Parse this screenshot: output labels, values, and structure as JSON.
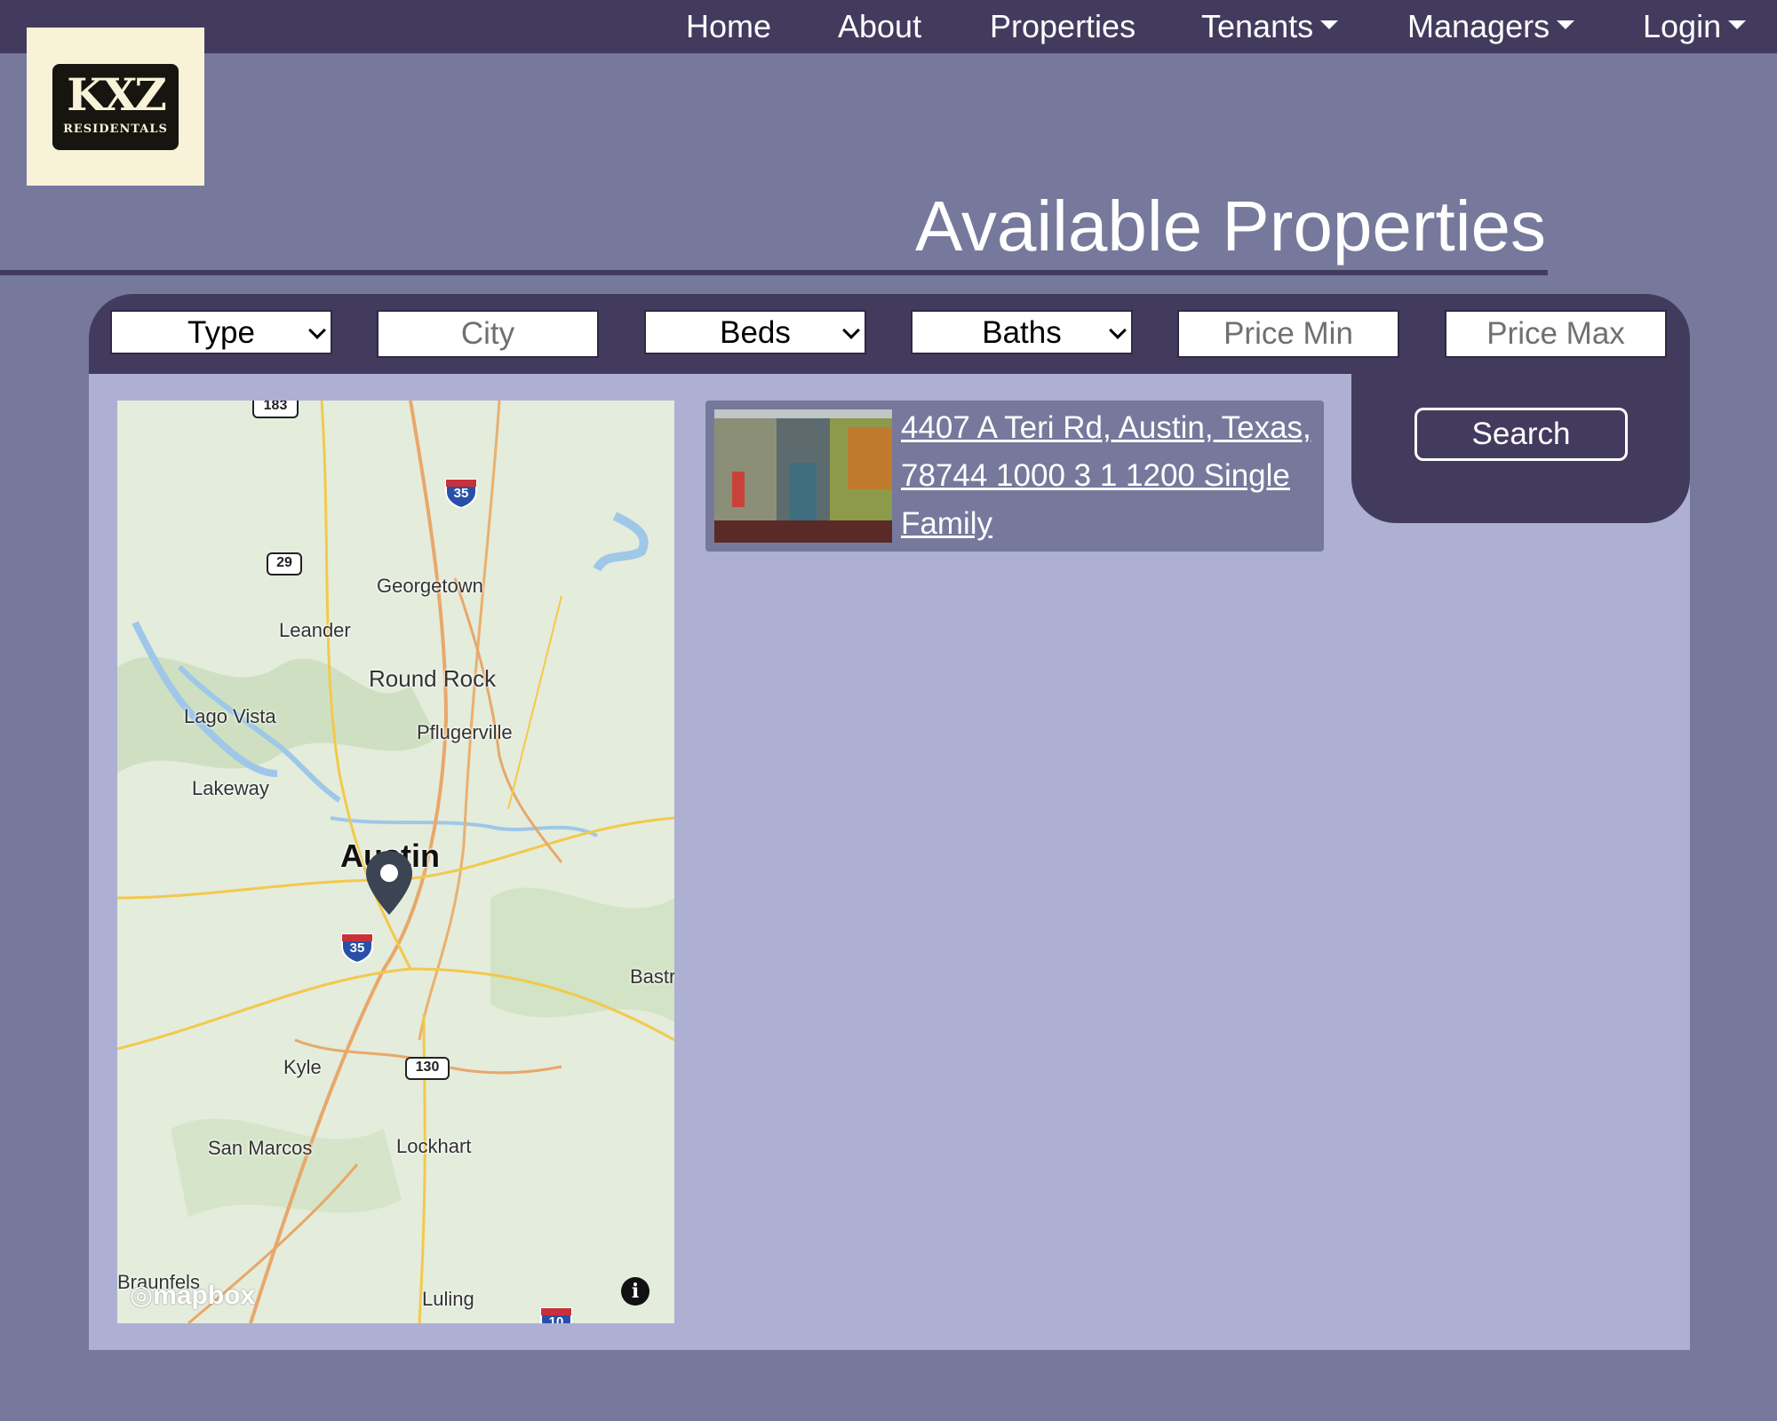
{
  "nav": {
    "items": [
      {
        "label": "Home"
      },
      {
        "label": "About"
      },
      {
        "label": "Properties"
      },
      {
        "label": "Tenants"
      },
      {
        "label": "Managers"
      },
      {
        "label": "Login"
      }
    ]
  },
  "logo": {
    "mark": "KXZ",
    "word": "RESIDENTALS"
  },
  "page": {
    "title": "Available Properties"
  },
  "filters": {
    "type": "Type",
    "city_placeholder": "City",
    "beds": "Beds",
    "baths": "Baths",
    "price_min_placeholder": "Price Min",
    "price_max_placeholder": "Price Max",
    "search_label": "Search"
  },
  "map": {
    "labels": [
      "Georgetown",
      "Leander",
      "Round Rock",
      "Lago Vista",
      "Pflugerville",
      "Lakeway",
      "Austin",
      "Bastr",
      "Kyle",
      "San Marcos",
      "Lockhart",
      "Braunfels",
      "Luling"
    ],
    "shields": [
      "183",
      "29",
      "130"
    ],
    "interstates": [
      "35",
      "35",
      "10"
    ],
    "attribution": "mapbox",
    "info": "i"
  },
  "listings": [
    {
      "text": "4407 A Teri Rd, Austin, Texas, 78744 1000 3 1 1200 Single Family"
    }
  ],
  "colors": {
    "page_bg": "#76789c",
    "nav_bg": "#433b5e",
    "panel_bg": "#adb0d2",
    "logo_bg": "#f8f3d8"
  }
}
